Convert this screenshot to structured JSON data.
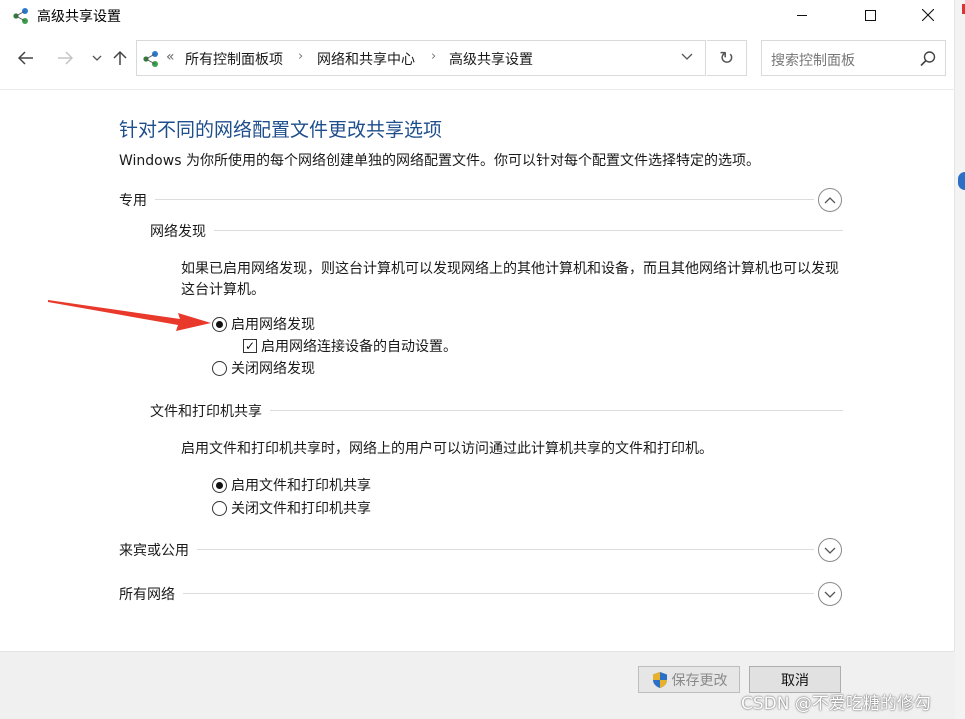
{
  "window": {
    "title": "高级共享设置",
    "icon": "network-sharing-icon"
  },
  "nav": {
    "back_icon": "arrow-left-icon",
    "forward_icon": "arrow-right-icon",
    "recent_icon": "chevron-down-icon",
    "up_icon": "arrow-up-icon"
  },
  "address": {
    "overflow": "«",
    "crumbs": [
      "所有控制面板项",
      "网络和共享中心",
      "高级共享设置"
    ],
    "separator": "›",
    "dropdown": "⌵",
    "refresh": "↻"
  },
  "search": {
    "placeholder": "搜索控制面板"
  },
  "content": {
    "heading": "针对不同的网络配置文件更改共享选项",
    "subtitle": "Windows 为你所使用的每个网络创建单独的网络配置文件。你可以针对每个配置文件选择特定的选项。",
    "sections": {
      "private": {
        "label": "专用",
        "expanded": true,
        "network_discovery": {
          "label": "网络发现",
          "description": "如果已启用网络发现，则这台计算机可以发现网络上的其他计算机和设备，而且其他网络计算机也可以发现这台计算机。",
          "options": [
            {
              "label": "启用网络发现",
              "checked": true
            },
            {
              "label": "启用网络连接设备的自动设置。",
              "checked": true,
              "type": "checkbox"
            },
            {
              "label": "关闭网络发现",
              "checked": false
            }
          ]
        },
        "file_printer_sharing": {
          "label": "文件和打印机共享",
          "description": "启用文件和打印机共享时，网络上的用户可以访问通过此计算机共享的文件和打印机。",
          "options": [
            {
              "label": "启用文件和打印机共享",
              "checked": true
            },
            {
              "label": "关闭文件和打印机共享",
              "checked": false
            }
          ]
        }
      },
      "guest_public": {
        "label": "来宾或公用",
        "expanded": false
      },
      "all_networks": {
        "label": "所有网络",
        "expanded": false
      }
    }
  },
  "footer": {
    "save_label": "保存更改",
    "save_enabled": false,
    "cancel_label": "取消",
    "watermark": "CSDN @不爱吃糖的修勾"
  },
  "colors": {
    "heading": "#1e4e8c",
    "annotation_arrow": "#e8392b",
    "footer_bg": "#f0f0f0"
  }
}
